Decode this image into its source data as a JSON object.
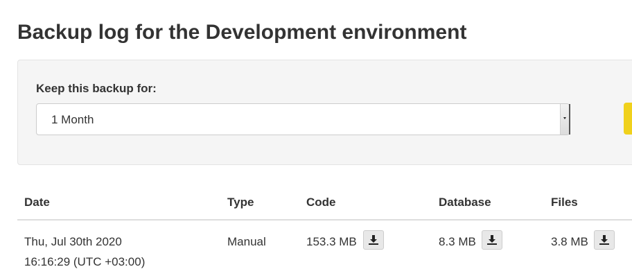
{
  "page": {
    "title": "Backup log for the Development environment"
  },
  "retention": {
    "label": "Keep this backup for:",
    "selected": "1 Month"
  },
  "table": {
    "headers": {
      "date": "Date",
      "type": "Type",
      "code": "Code",
      "database": "Database",
      "files": "Files"
    },
    "rows": [
      {
        "date_line1": "Thu, Jul 30th 2020",
        "date_line2": "16:16:29 (UTC +03:00)",
        "type": "Manual",
        "code_size": "153.3 MB",
        "database_size": "8.3 MB",
        "files_size": "3.8 MB"
      }
    ]
  },
  "icons": {
    "download": "download-icon"
  },
  "colors": {
    "accent_button": "#f0d11c",
    "panel_background": "#f5f5f5",
    "text": "#333333"
  }
}
